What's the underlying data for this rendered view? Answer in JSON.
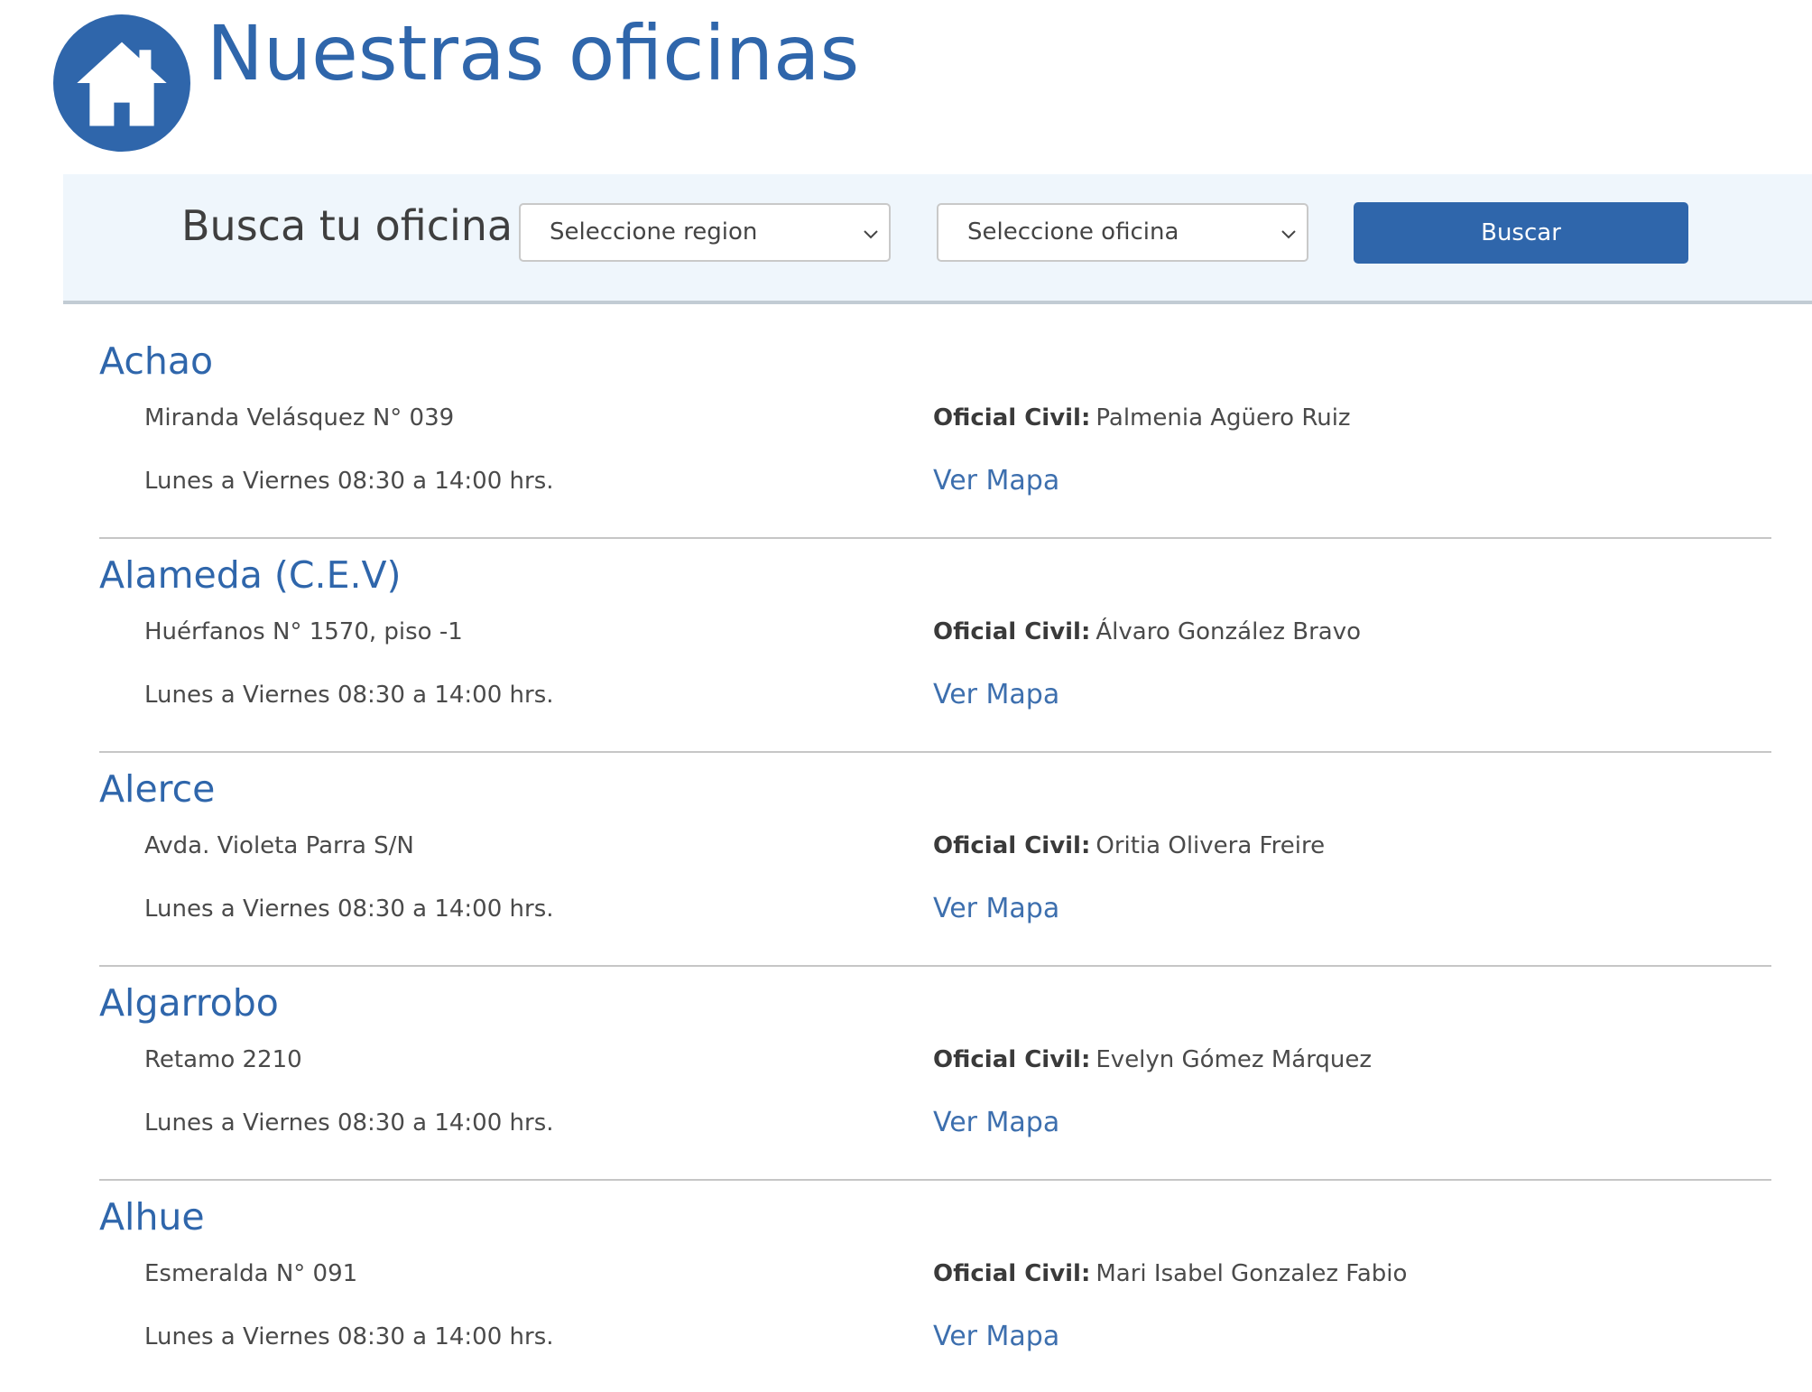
{
  "header": {
    "title": "Nuestras oficinas",
    "logo_icon": "home-icon",
    "brand_color": "#2f66ab"
  },
  "search": {
    "heading": "Busca tu oficina",
    "region_select": {
      "selected": "Seleccione region",
      "icon": "chevron-down-icon"
    },
    "office_select": {
      "selected": "Seleccione oficina",
      "icon": "chevron-down-icon"
    },
    "button_label": "Buscar",
    "bar_color": "#eff6fc"
  },
  "offices": [
    {
      "name": "Achao",
      "address": "Miranda Velásquez N° 039",
      "hours": "Lunes a Viernes 08:30 a 14:00 hrs.",
      "official_label": "Oficial Civil:",
      "official_name": "Palmenia Agüero Ruiz",
      "map_label": "Ver Mapa"
    },
    {
      "name": "Alameda (C.E.V)",
      "address": "Huérfanos N° 1570, piso -1",
      "hours": "Lunes a Viernes 08:30 a 14:00 hrs.",
      "official_label": "Oficial Civil:",
      "official_name": "Álvaro González Bravo",
      "map_label": "Ver Mapa"
    },
    {
      "name": "Alerce",
      "address": "Avda. Violeta Parra S/N",
      "hours": "Lunes a Viernes 08:30 a 14:00 hrs.",
      "official_label": "Oficial Civil:",
      "official_name": "Oritia Olivera Freire",
      "map_label": "Ver Mapa"
    },
    {
      "name": "Algarrobo",
      "address": "Retamo 2210",
      "hours": "Lunes a Viernes 08:30 a 14:00 hrs.",
      "official_label": "Oficial Civil:",
      "official_name": "Evelyn Gómez Márquez",
      "map_label": "Ver Mapa"
    },
    {
      "name": "Alhue",
      "address": "Esmeralda N° 091",
      "hours": "Lunes a Viernes 08:30 a 14:00 hrs.",
      "official_label": "Oficial Civil:",
      "official_name": "Mari Isabel Gonzalez Fabio",
      "map_label": "Ver Mapa"
    }
  ]
}
